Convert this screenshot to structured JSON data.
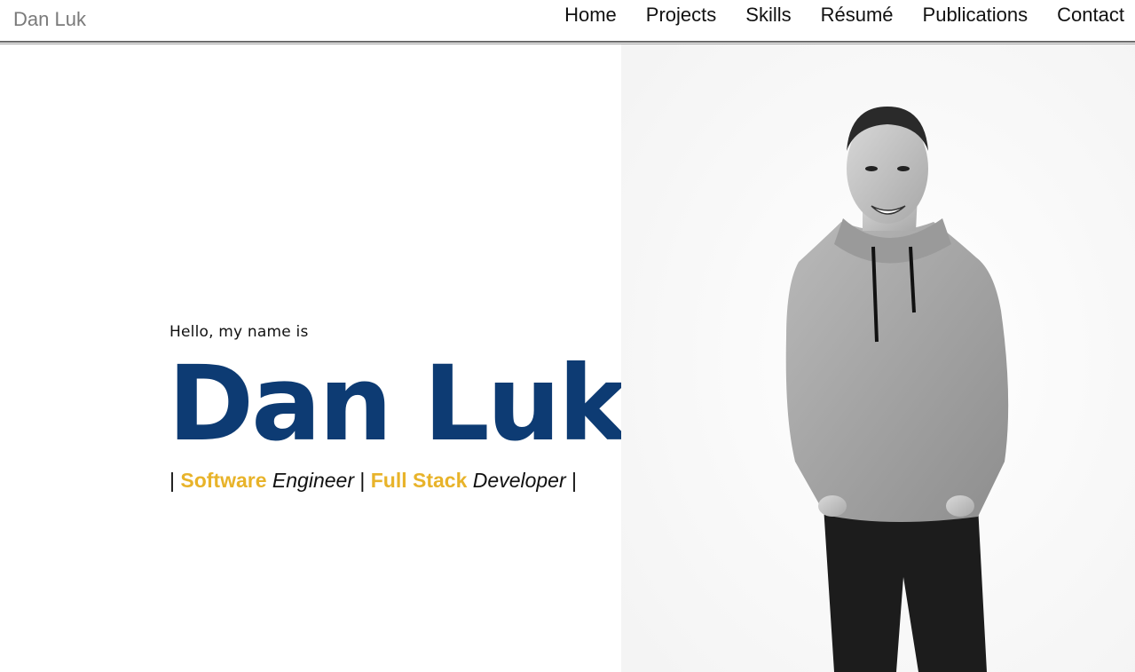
{
  "nav": {
    "brand": "Dan Luk",
    "links": [
      "Home",
      "Projects",
      "Skills",
      "Résumé",
      "Publications",
      "Contact"
    ]
  },
  "hero": {
    "greeting": "Hello, my name is",
    "name": "Dan Luk",
    "roles": {
      "sep": "|",
      "role1_accent": "Software",
      "role1_rest": "Engineer",
      "role2_accent": "Full Stack",
      "role2_rest": "Developer"
    }
  },
  "colors": {
    "name_blue": "#0d3b73",
    "accent_gold": "#e8b32a"
  },
  "icons": {
    "portrait": "person-portrait-photo"
  }
}
